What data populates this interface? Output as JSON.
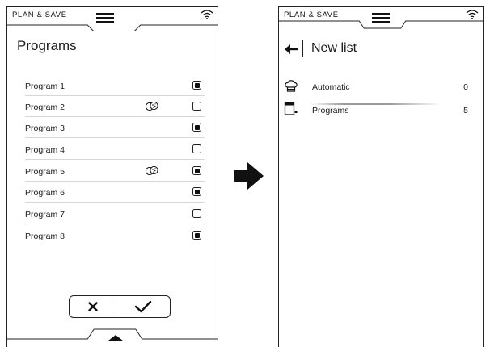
{
  "left_screen": {
    "brand": "PLAN & SAVE",
    "title": "Programs",
    "programs": [
      {
        "label": "Program 1",
        "checked": true,
        "has_cookie_icon": false
      },
      {
        "label": "Program 2",
        "checked": false,
        "has_cookie_icon": true
      },
      {
        "label": "Program 3",
        "checked": true,
        "has_cookie_icon": false
      },
      {
        "label": "Program 4",
        "checked": false,
        "has_cookie_icon": false
      },
      {
        "label": "Program 5",
        "checked": true,
        "has_cookie_icon": true
      },
      {
        "label": "Program 6",
        "checked": true,
        "has_cookie_icon": false
      },
      {
        "label": "Program 7",
        "checked": false,
        "has_cookie_icon": false
      },
      {
        "label": "Program 8",
        "checked": true,
        "has_cookie_icon": false
      }
    ],
    "actions": {
      "cancel_icon": "close-icon",
      "confirm_icon": "checkmark-icon"
    }
  },
  "right_screen": {
    "brand": "PLAN & SAVE",
    "title": "New list",
    "items": [
      {
        "label": "Automatic",
        "count": "0",
        "icon": "chef-hat-icon"
      },
      {
        "label": "Programs",
        "count": "5",
        "icon": "oven-program-icon"
      }
    ]
  },
  "transition_icon": "right-arrow-icon",
  "colors": {
    "ink": "#111111",
    "divider": "#d6d6d6",
    "background": "#ffffff"
  }
}
